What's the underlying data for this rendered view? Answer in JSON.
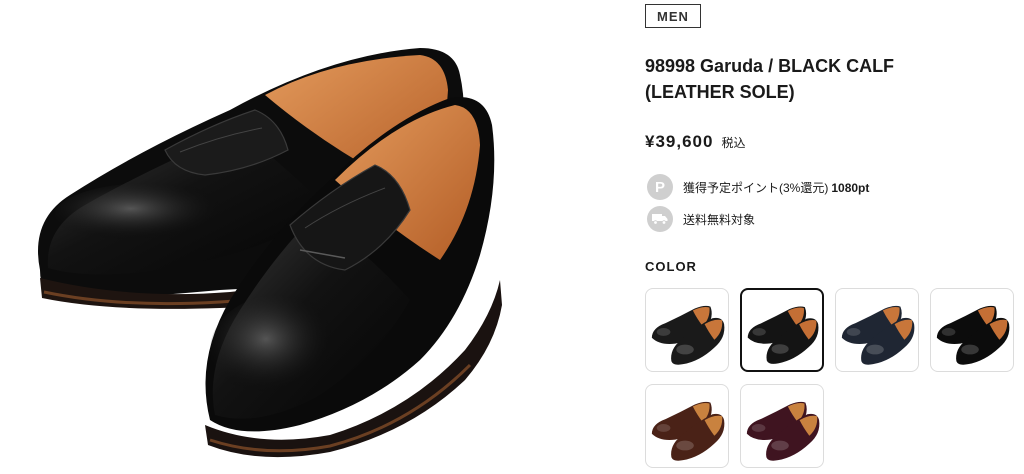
{
  "product": {
    "category": "MEN",
    "title_line1": "98998 Garuda / BLACK CALF",
    "title_line2": "(LEATHER SOLE)",
    "price": "¥39,600",
    "tax_label": "税込"
  },
  "info": {
    "points_icon_glyph": "P",
    "points_text": "獲得予定ポイント(3%還元)",
    "points_value": "1080pt",
    "shipping_text": "送料無料対象"
  },
  "colors": {
    "heading": "COLOR",
    "selected_index": 1,
    "swatches": [
      {
        "name": "black-calf-variant-a",
        "upper": "#1a1a1a",
        "lining": "#c8763a"
      },
      {
        "name": "black-calf",
        "upper": "#141414",
        "lining": "#c46f35"
      },
      {
        "name": "navy",
        "upper": "#1f2633",
        "lining": "#c8763a"
      },
      {
        "name": "black-suede",
        "upper": "#0c0c0c",
        "lining": "#c46f35"
      },
      {
        "name": "brown",
        "upper": "#4a2217",
        "lining": "#c9823f"
      },
      {
        "name": "burgundy",
        "upper": "#3f1420",
        "lining": "#c9823f"
      }
    ]
  },
  "theme": {
    "badge_border": "#333333",
    "selected_border": "#111111",
    "icon_bg": "#cfcfcf"
  }
}
